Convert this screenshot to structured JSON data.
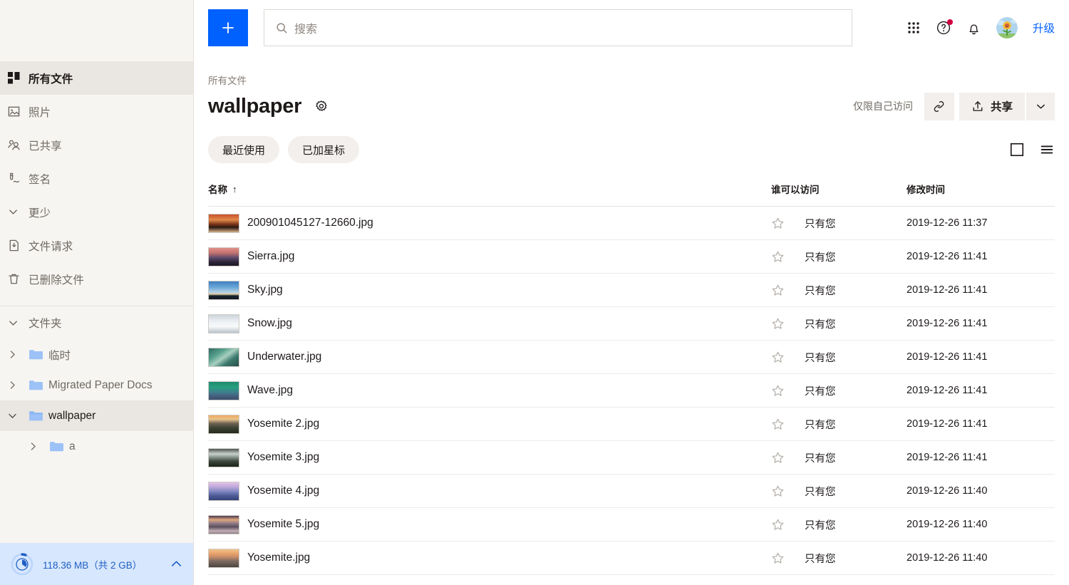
{
  "sidebar": {
    "nav_items": [
      {
        "label": "所有文件",
        "icon": "all-files-icon",
        "active": true
      },
      {
        "label": "照片",
        "icon": "photos-icon",
        "active": false
      },
      {
        "label": "已共享",
        "icon": "shared-icon",
        "active": false
      },
      {
        "label": "签名",
        "icon": "signature-icon",
        "active": false
      },
      {
        "label": "更少",
        "icon": "chevron-down-icon",
        "active": false
      },
      {
        "label": "文件请求",
        "icon": "file-request-icon",
        "active": false
      },
      {
        "label": "已删除文件",
        "icon": "trash-icon",
        "active": false
      }
    ],
    "folders_section_label": "文件夹",
    "tree": [
      {
        "label": "临时",
        "expanded": false,
        "selected": false,
        "indent": false
      },
      {
        "label": "Migrated Paper Docs",
        "expanded": false,
        "selected": false,
        "indent": false
      },
      {
        "label": "wallpaper",
        "expanded": true,
        "selected": true,
        "indent": false
      },
      {
        "label": "a",
        "expanded": false,
        "selected": false,
        "indent": true
      }
    ],
    "storage": {
      "text": "118.36 MB（共 2 GB）",
      "used_mb": 118.36,
      "total_gb": 2,
      "percent": 5.8,
      "accent": "#1f5fc4",
      "background": "#d7e7fd"
    }
  },
  "topbar": {
    "new_button_label": "+",
    "search_placeholder": "搜索",
    "search_value": "",
    "apps_icon": "grid-apps-icon",
    "help_icon": "help-circle-icon",
    "notifications_icon": "bell-icon",
    "avatar_icon": "user-avatar",
    "upgrade_label": "升级",
    "accent": "#0061fe"
  },
  "header": {
    "breadcrumb": "所有文件",
    "title": "wallpaper",
    "settings_icon": "gear-icon",
    "access_note": "仅限自己访问",
    "link_icon": "link-icon",
    "share_label": "共享",
    "share_icon": "share-upload-icon",
    "share_caret_icon": "chevron-down-icon"
  },
  "filters": {
    "pills": [
      {
        "label": "最近使用"
      },
      {
        "label": "已加星标"
      }
    ],
    "view_grid_icon": "grid-view-icon",
    "view_list_icon": "list-view-icon"
  },
  "table": {
    "columns": {
      "name": "名称",
      "sort_indicator": "↑",
      "access": "谁可以访问",
      "modified": "修改时间"
    },
    "rows": [
      {
        "name": "200901045127-12660.jpg",
        "access": "只有您",
        "modified": "2019-12-26 11:37",
        "starred": false,
        "thumb": "sunset-trees"
      },
      {
        "name": "Sierra.jpg",
        "access": "只有您",
        "modified": "2019-12-26 11:41",
        "starred": false,
        "thumb": "sierra-mountains"
      },
      {
        "name": "Sky.jpg",
        "access": "只有您",
        "modified": "2019-12-26 11:41",
        "starred": false,
        "thumb": "blue-sky"
      },
      {
        "name": "Snow.jpg",
        "access": "只有您",
        "modified": "2019-12-26 11:41",
        "starred": false,
        "thumb": "snow-white"
      },
      {
        "name": "Underwater.jpg",
        "access": "只有您",
        "modified": "2019-12-26 11:41",
        "starred": false,
        "thumb": "underwater-teal"
      },
      {
        "name": "Wave.jpg",
        "access": "只有您",
        "modified": "2019-12-26 11:41",
        "starred": false,
        "thumb": "wave-green"
      },
      {
        "name": "Yosemite 2.jpg",
        "access": "只有您",
        "modified": "2019-12-26 11:41",
        "starred": false,
        "thumb": "yosemite-dawn"
      },
      {
        "name": "Yosemite 3.jpg",
        "access": "只有您",
        "modified": "2019-12-26 11:41",
        "starred": false,
        "thumb": "yosemite-dark"
      },
      {
        "name": "Yosemite 4.jpg",
        "access": "只有您",
        "modified": "2019-12-26 11:40",
        "starred": false,
        "thumb": "yosemite-purple"
      },
      {
        "name": "Yosemite 5.jpg",
        "access": "只有您",
        "modified": "2019-12-26 11:40",
        "starred": false,
        "thumb": "yosemite-lake"
      },
      {
        "name": "Yosemite.jpg",
        "access": "只有您",
        "modified": "2019-12-26 11:40",
        "starred": false,
        "thumb": "yosemite-sunset"
      }
    ]
  }
}
